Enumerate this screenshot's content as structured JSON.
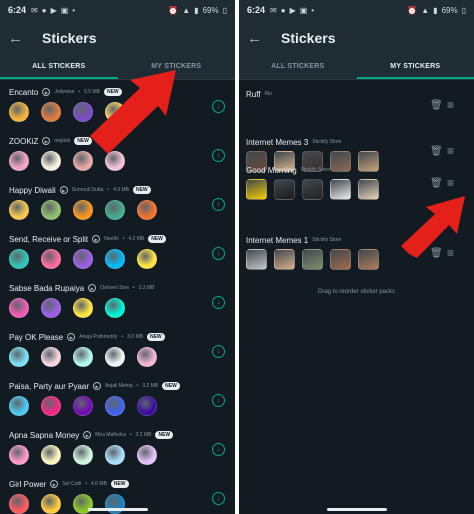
{
  "left": {
    "status": {
      "time": "6:24",
      "battery": "69%"
    },
    "appbar": {
      "title": "Stickers"
    },
    "tabs": [
      {
        "label": "ALL STICKERS"
      },
      {
        "label": "MY STICKERS"
      }
    ],
    "packs": [
      {
        "name": "Encanto",
        "author": "Jollywise",
        "size": "5.5 MB",
        "badge": "NEW"
      },
      {
        "name": "ZOOKiZ",
        "author": "mojitok",
        "size": "",
        "badge": "NEW"
      },
      {
        "name": "Happy Diwali",
        "author": "Surnouli Dutta",
        "size": "4.9 MB",
        "badge": "NEW"
      },
      {
        "name": "Send, Receive or Split",
        "author": "Neethi",
        "size": "4.2 MB",
        "badge": "NEW"
      },
      {
        "name": "Sabse Bada Rupaiya",
        "author": "Osheen Siva",
        "size": "3.3 MB",
        "badge": ""
      },
      {
        "name": "Pay OK Please",
        "author": "Anuja Pothireddy",
        "size": "3.0 MB",
        "badge": "NEW"
      },
      {
        "name": "Paisa, Party aur Pyaar",
        "author": "Anjali Mehta",
        "size": "3.2 MB",
        "badge": "NEW"
      },
      {
        "name": "Apna Sapna Money",
        "author": "Mira Malhotra",
        "size": "3.2 MB",
        "badge": "NEW"
      },
      {
        "name": "Girl Power",
        "author": "Sol Cotti",
        "size": "4.6 MB",
        "badge": "NEW"
      }
    ]
  },
  "right": {
    "status": {
      "time": "6:24",
      "battery": "69%"
    },
    "appbar": {
      "title": "Stickers"
    },
    "tabs": [
      {
        "label": "ALL STICKERS"
      },
      {
        "label": "MY STICKERS"
      }
    ],
    "packs": [
      {
        "name": "Ruff",
        "author": "Rio"
      },
      {
        "name": "Internet Memes 3",
        "author": "Stickify Store"
      },
      {
        "name": "Good Morning",
        "author": "Stickify Store"
      },
      {
        "name": "Internet Memes 1",
        "author": "Stickify Store"
      }
    ],
    "hint": "Drag to reorder sticker packs"
  },
  "colors": {
    "background": "#121b22",
    "bar": "#1f2c34",
    "accent": "#00a884",
    "arrow": "#e5201b"
  }
}
